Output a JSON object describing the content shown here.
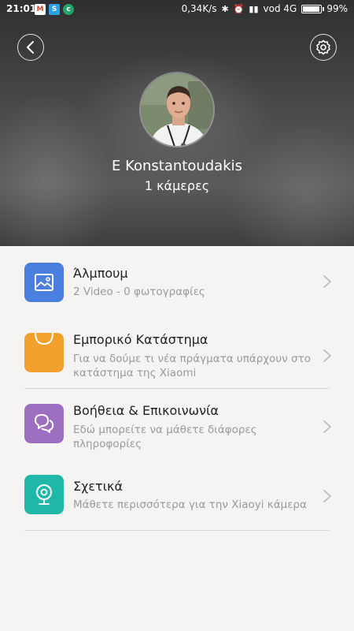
{
  "status_bar": {
    "time": "21:01",
    "network_speed": "0,34K/s",
    "carrier": "vod 4G",
    "battery": "99%",
    "battery_level": 0.99,
    "app_icons": [
      "gmail-icon",
      "skype-icon",
      "notification-app-icon"
    ]
  },
  "profile": {
    "name": "E Konstantoudakis",
    "cameras": "1 κάμερες"
  },
  "menu": {
    "items": [
      {
        "title": "Άλμπουμ",
        "desc": "2 Video - 0 φωτογραφίες",
        "color": "#4a7fe0",
        "icon": "album-icon"
      },
      {
        "title": "Εμπορικό Κατάστημα",
        "desc": "Για να δούμε τι νέα πράγματα υπάρχουν στο κατάστημα της Xiaomi",
        "color": "#f2a02c",
        "icon": "shopping-bag-icon"
      },
      {
        "title": "Βοήθεια & Επικοινωνία",
        "desc": "Εδώ μπορείτε να μάθετε διάφορες πληροφορίες",
        "color": "#9d6fc0",
        "icon": "chat-bubbles-icon"
      },
      {
        "title": "Σχετικά",
        "desc": "Μάθετε περισσότερα για την Xiaoyi κάμερα",
        "color": "#1fb8a8",
        "icon": "camera-icon"
      }
    ]
  },
  "colors": {
    "background": "#f5f4f2",
    "divider": "#d6d6d6",
    "secondary_text": "#9a9a9a"
  }
}
